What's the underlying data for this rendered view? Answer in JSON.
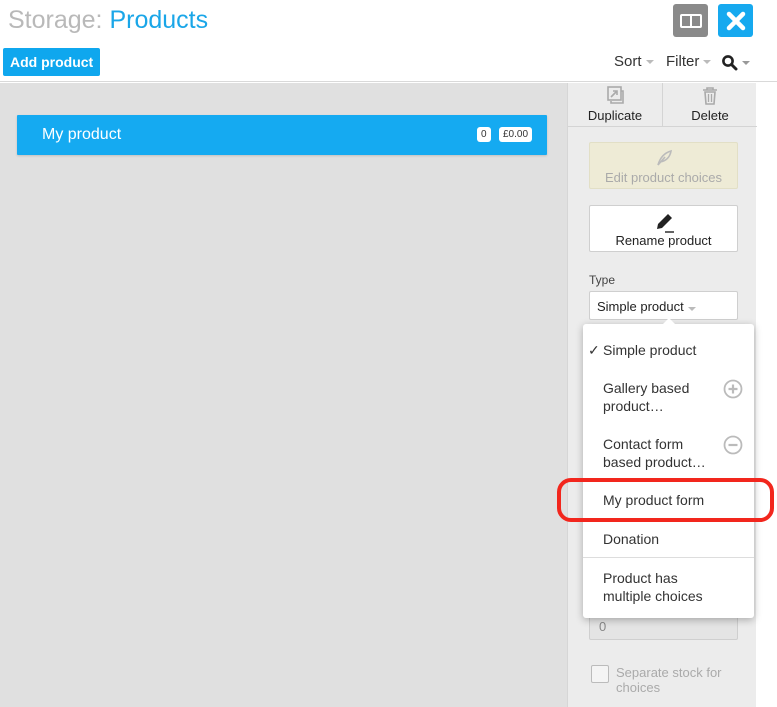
{
  "header": {
    "title_prefix": "Storage: ",
    "title_accent": "Products",
    "add_button": "Add product",
    "sort_label": "Sort",
    "filter_label": "Filter"
  },
  "product": {
    "name": "My product",
    "count_badge": "0",
    "price_badge": "£0.00"
  },
  "side": {
    "duplicate": "Duplicate",
    "delete": "Delete",
    "edit_choices": "Edit product choices",
    "rename": "Rename product",
    "type_label": "Type",
    "type_value": "Simple product",
    "stock_value": "0",
    "separate_stock": "Separate stock for choices"
  },
  "dropdown": {
    "items": [
      {
        "label": "Simple product",
        "checked": true
      },
      {
        "label": "Gallery based product…",
        "icon": "plus-circle-icon"
      },
      {
        "label": "Contact form based product…",
        "icon": "minus-circle-icon"
      },
      {
        "label": "My product form"
      },
      {
        "label": "Donation"
      },
      {
        "label": "Product has multiple choices"
      }
    ]
  },
  "colors": {
    "accent": "#15aaf1",
    "highlight": "#f2261d"
  }
}
